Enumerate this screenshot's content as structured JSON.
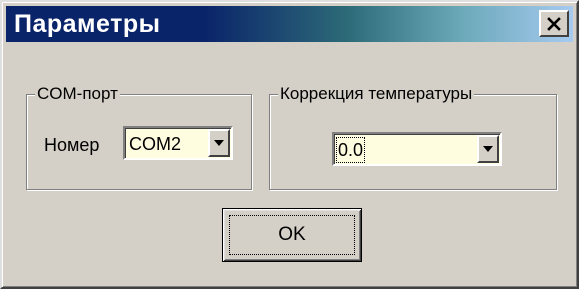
{
  "window": {
    "title": "Параметры"
  },
  "com_port": {
    "group_label": "COM-порт",
    "number_label": "Номер",
    "selected": "COM2"
  },
  "temperature": {
    "group_label": "Коррекция температуры",
    "selected": "0.0"
  },
  "buttons": {
    "ok_label": "OK"
  },
  "icons": {
    "close": "close-icon",
    "dropdown": "chevron-down-icon"
  },
  "colors": {
    "title_gradient_start": "#0a246a",
    "title_gradient_end": "#a6caf0",
    "face": "#d4d0c8",
    "combo_background": "#fffde0"
  }
}
